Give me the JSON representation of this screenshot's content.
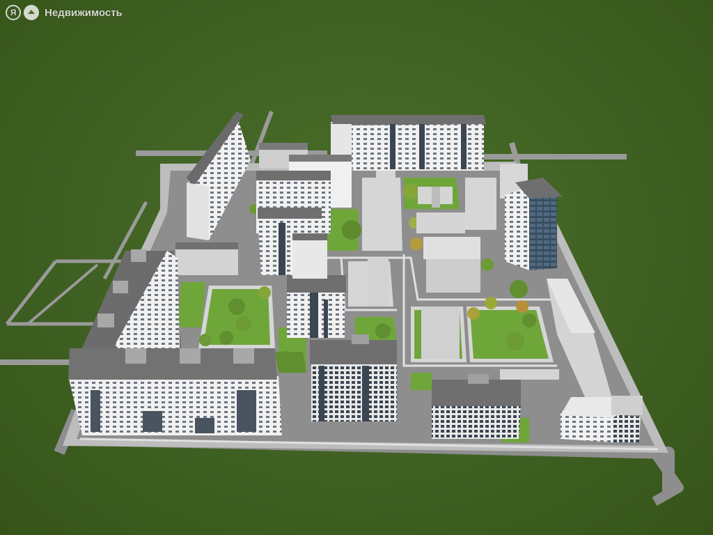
{
  "watermark": {
    "logo_letter": "Я",
    "brand_text": "Недвижимость"
  },
  "colors": {
    "grass": "#3f6224",
    "road": "#8e8e8e",
    "sidewalk": "#d9d9d9",
    "roof": "#6f6f6f",
    "facade": "#f2f2f2",
    "glass": "#3b4652",
    "courtyard": "#6fa63a",
    "tree": "#5f8f2e"
  },
  "icons": [
    "yandex-logo-icon",
    "house-icon"
  ]
}
